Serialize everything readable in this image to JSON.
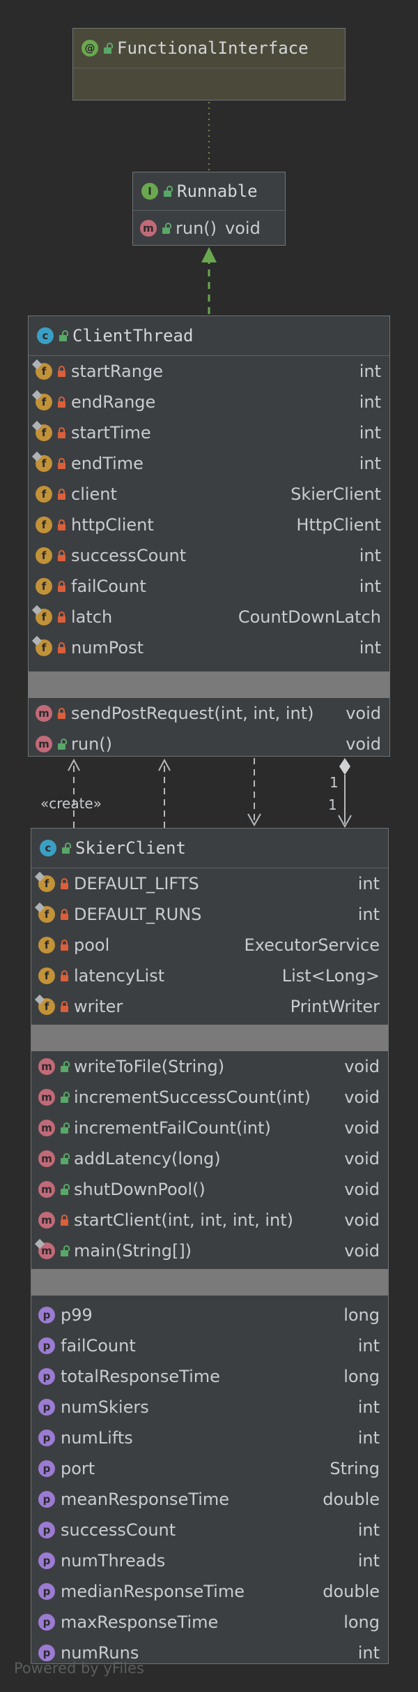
{
  "diagram": {
    "functional_interface": {
      "title": "FunctionalInterface",
      "icon": "annotation-icon"
    },
    "runnable": {
      "title": "Runnable",
      "methods": [
        {
          "name": "run()",
          "type": "void"
        }
      ]
    },
    "client_thread": {
      "title": "ClientThread",
      "fields": [
        {
          "name": "startRange",
          "type": "int"
        },
        {
          "name": "endRange",
          "type": "int"
        },
        {
          "name": "startTime",
          "type": "int"
        },
        {
          "name": "endTime",
          "type": "int"
        },
        {
          "name": "client",
          "type": "SkierClient"
        },
        {
          "name": "httpClient",
          "type": "HttpClient"
        },
        {
          "name": "successCount",
          "type": "int"
        },
        {
          "name": "failCount",
          "type": "int"
        },
        {
          "name": "latch",
          "type": "CountDownLatch"
        },
        {
          "name": "numPost",
          "type": "int"
        }
      ],
      "methods": [
        {
          "name": "sendPostRequest(int, int, int)",
          "type": "void"
        },
        {
          "name": "run()",
          "type": "void"
        }
      ]
    },
    "skier_client": {
      "title": "SkierClient",
      "fields": [
        {
          "name": "DEFAULT_LIFTS",
          "type": "int"
        },
        {
          "name": "DEFAULT_RUNS",
          "type": "int"
        },
        {
          "name": "pool",
          "type": "ExecutorService"
        },
        {
          "name": "latencyList",
          "type": "List<Long>"
        },
        {
          "name": "writer",
          "type": "PrintWriter"
        }
      ],
      "methods": [
        {
          "name": "writeToFile(String)",
          "type": "void"
        },
        {
          "name": "incrementSuccessCount(int)",
          "type": "void"
        },
        {
          "name": "incrementFailCount(int)",
          "type": "void"
        },
        {
          "name": "addLatency(long)",
          "type": "void"
        },
        {
          "name": "shutDownPool()",
          "type": "void"
        },
        {
          "name": "startClient(int, int, int, int)",
          "type": "void"
        },
        {
          "name": "main(String[])",
          "type": "void"
        }
      ],
      "properties": [
        {
          "name": "p99",
          "type": "long"
        },
        {
          "name": "failCount",
          "type": "int"
        },
        {
          "name": "totalResponseTime",
          "type": "long"
        },
        {
          "name": "numSkiers",
          "type": "int"
        },
        {
          "name": "numLifts",
          "type": "int"
        },
        {
          "name": "port",
          "type": "String"
        },
        {
          "name": "meanResponseTime",
          "type": "double"
        },
        {
          "name": "successCount",
          "type": "int"
        },
        {
          "name": "numThreads",
          "type": "int"
        },
        {
          "name": "medianResponseTime",
          "type": "double"
        },
        {
          "name": "maxResponseTime",
          "type": "long"
        },
        {
          "name": "numRuns",
          "type": "int"
        }
      ]
    },
    "edges": {
      "create_label": "«create»",
      "multiplicity_source": "1",
      "multiplicity_target": "1"
    },
    "footer": "Powered by yFiles",
    "colors": {
      "background": "#2b2b2b",
      "node_fill": "#3c3f41",
      "annotation_fill": "#4b4a3a",
      "implements_arrow": "#6aa84f",
      "field_icon": "#c29238",
      "method_icon": "#c26a79",
      "property_icon": "#9b7bd3",
      "class_icon": "#3a9fc4"
    }
  }
}
